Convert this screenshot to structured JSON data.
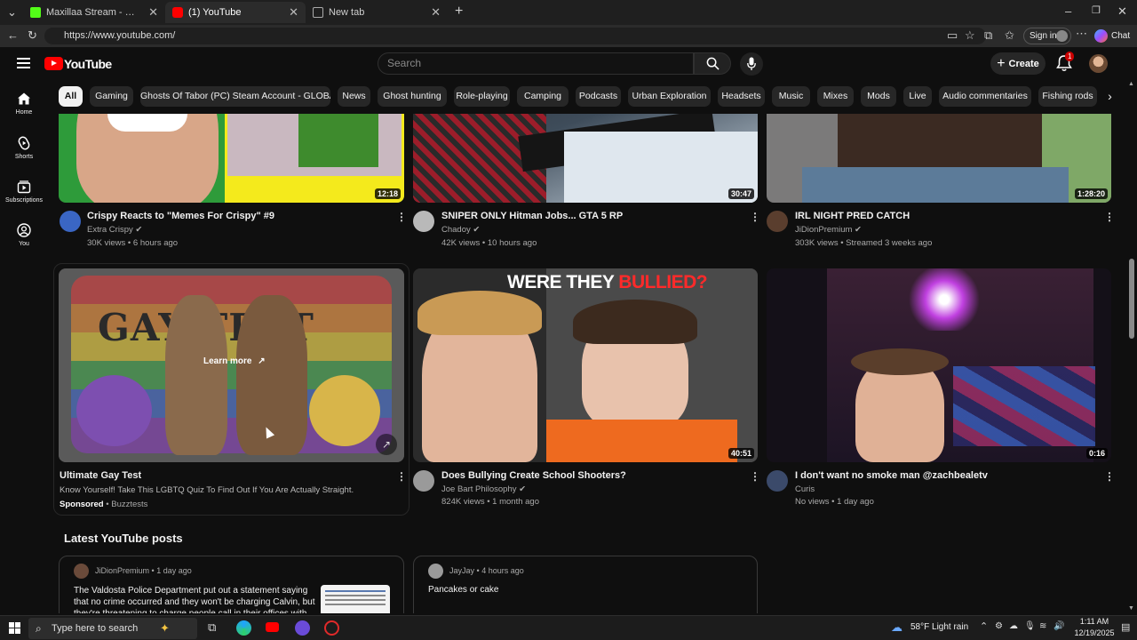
{
  "browser": {
    "tabs": [
      {
        "label": "Maxillaa Stream - Watch Live on K",
        "active": false
      },
      {
        "label": "(1) YouTube",
        "active": true
      },
      {
        "label": "New tab",
        "active": false
      }
    ],
    "url": "https://www.youtube.com/",
    "sign_in": "Sign in",
    "chat": "Chat"
  },
  "yt_header": {
    "logo": "YouTube",
    "search_placeholder": "Search",
    "create": "Create",
    "notification_count": "1"
  },
  "left_nav": [
    {
      "label": "Home",
      "icon": "home-icon"
    },
    {
      "label": "Shorts",
      "icon": "shorts-icon"
    },
    {
      "label": "Subscriptions",
      "icon": "subscriptions-icon"
    },
    {
      "label": "You",
      "icon": "you-icon"
    }
  ],
  "chips": [
    "All",
    "Gaming",
    "Ghosts Of Tabor (PC) Steam Account - GLOBAL",
    "News",
    "Ghost hunting",
    "Role-playing",
    "Camping",
    "Podcasts",
    "Urban Exploration",
    "Headsets",
    "Music",
    "Mixes",
    "Mods",
    "Live",
    "Audio commentaries",
    "Fishing rods"
  ],
  "videos_row1": [
    {
      "title": "Crispy Reacts to \"Memes For Crispy\" #9",
      "channel": "Extra Crispy",
      "meta": "30K views • 6 hours ago",
      "duration": "12:18"
    },
    {
      "title": "SNIPER ONLY Hitman Jobs... GTA 5 RP",
      "channel": "Chadoy",
      "meta": "42K views • 10 hours ago",
      "duration": "30:47"
    },
    {
      "title": "IRL NIGHT PRED CATCH",
      "channel": "JiDionPremium",
      "meta": "303K views • Streamed 3 weeks ago",
      "duration": "1:28:20"
    }
  ],
  "ad": {
    "title": "Ultimate Gay Test",
    "description": "Know Yourself! Take This LGBTQ Quiz To Find Out If You Are Actually Straight.",
    "sponsored": "Sponsored",
    "advertiser": "Buzztests",
    "learn_more": "Learn more",
    "thumb_text": "GAY TEST"
  },
  "videos_row2": [
    {
      "title": "Does Bullying Create School Shooters?",
      "channel": "Joe Bart Philosophy",
      "meta": "824K views • 1 month ago",
      "duration": "40:51",
      "thumb_text_a": "WERE THEY ",
      "thumb_text_b": "BULLIED?"
    },
    {
      "title": "I don't want no smoke man @zachbealetv",
      "channel": "Curis",
      "meta": "No views • 1 day ago",
      "duration": "0:16"
    }
  ],
  "posts_section": {
    "heading": "Latest YouTube posts",
    "posts": [
      {
        "author": "JiDionPremium",
        "time": "1 day ago",
        "text": "The Valdosta Police Department put out a statement saying that no crime occurred and they won't be charging Calvin, but they're threatening to charge people call in their offices with..."
      },
      {
        "author": "JayJay",
        "time": "4 hours ago",
        "text": "Pancakes or cake"
      }
    ]
  },
  "taskbar": {
    "search_placeholder": "Type here to search",
    "weather": "58°F  Light rain",
    "time": "1:11 AM",
    "date": "12/19/2025"
  },
  "colors": {
    "background": "#0f0f0f",
    "youtube_red": "#ff0000",
    "chip_bg": "#272727",
    "meta_text": "#aaaaaa"
  }
}
